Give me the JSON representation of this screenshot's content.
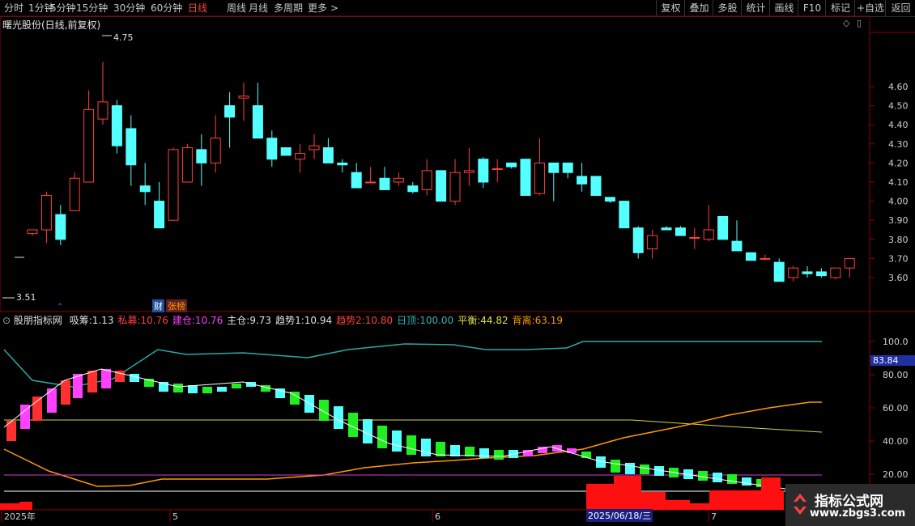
{
  "toolbar": {
    "periods": [
      "分时",
      "1分钟",
      "5分钟",
      "15分钟",
      "30分钟",
      "60分钟",
      "日线",
      "周线",
      "月线",
      "多周期",
      "更多 >"
    ],
    "active": "日线",
    "buttons": [
      "复权",
      "叠加",
      "多股",
      "统计",
      "画线",
      "F10",
      "标记",
      "+自选",
      "返回"
    ]
  },
  "main": {
    "title": "曙光股份(日线,前复权)",
    "high_label": "4.75",
    "low_label": "3.51",
    "badges": [
      "财",
      "张榜"
    ],
    "yaxis": [
      "4.60",
      "4.50",
      "4.40",
      "4.30",
      "4.20",
      "4.10",
      "4.00",
      "3.90",
      "3.80",
      "3.70",
      "3.60"
    ]
  },
  "indicator": {
    "name": "股朋指标网",
    "items": [
      {
        "label": "吸筹:",
        "value": "1.13",
        "color": "#e0e0e0"
      },
      {
        "label": "私募:",
        "value": "10.76",
        "color": "#ff4040"
      },
      {
        "label": "建仓:",
        "value": "10.76",
        "color": "#ff40ff"
      },
      {
        "label": "主仓:",
        "value": "9.73",
        "color": "#e0e0e0"
      },
      {
        "label": "趋势1:",
        "value": "10.94",
        "color": "#e0e0e0"
      },
      {
        "label": "趋势2:",
        "value": "10.80",
        "color": "#ff4040"
      },
      {
        "label": "日顶:",
        "value": "100.00",
        "color": "#33b5b5"
      },
      {
        "label": "平衡:",
        "value": "44.82",
        "color": "#e0e040"
      },
      {
        "label": "背离:",
        "value": "63.19",
        "color": "#ff9900"
      }
    ],
    "yaxis": [
      "100.0",
      "80.00",
      "60.00",
      "40.00",
      "20.00"
    ],
    "current": "83.84"
  },
  "xaxis": {
    "labels": [
      "2025年",
      "5",
      "6",
      "7"
    ],
    "cursor_date": "2025/06/18/三"
  },
  "watermark": {
    "title": "指标公式网",
    "url": "www.zbgs3.com"
  },
  "chart_data": {
    "type": "candlestick",
    "ylim": [
      3.5,
      4.8
    ],
    "candles": [
      [
        3.83,
        3.85,
        3.82,
        3.85
      ],
      [
        3.85,
        4.05,
        3.78,
        4.03
      ],
      [
        3.93,
        3.98,
        3.77,
        3.8
      ],
      [
        3.95,
        4.15,
        3.95,
        4.12
      ],
      [
        4.1,
        4.58,
        4.1,
        4.48
      ],
      [
        4.43,
        4.73,
        4.4,
        4.52
      ],
      [
        4.5,
        4.53,
        4.25,
        4.29
      ],
      [
        4.38,
        4.45,
        4.08,
        4.19
      ],
      [
        4.08,
        4.2,
        3.98,
        4.05
      ],
      [
        4.0,
        4.1,
        3.86,
        3.86
      ],
      [
        3.9,
        4.28,
        3.9,
        4.27
      ],
      [
        4.1,
        4.3,
        4.1,
        4.28
      ],
      [
        4.27,
        4.35,
        4.08,
        4.2
      ],
      [
        4.2,
        4.45,
        4.15,
        4.33
      ],
      [
        4.5,
        4.57,
        4.28,
        4.44
      ],
      [
        4.54,
        4.62,
        4.42,
        4.55
      ],
      [
        4.5,
        4.62,
        4.33,
        4.33
      ],
      [
        4.33,
        4.37,
        4.18,
        4.22
      ],
      [
        4.28,
        4.25,
        4.25,
        4.24
      ],
      [
        4.22,
        4.3,
        4.15,
        4.25
      ],
      [
        4.27,
        4.35,
        4.22,
        4.29
      ],
      [
        4.28,
        4.33,
        4.2,
        4.2
      ],
      [
        4.2,
        4.22,
        4.15,
        4.19
      ],
      [
        4.15,
        4.2,
        4.07,
        4.07
      ],
      [
        4.1,
        4.18,
        4.1,
        4.1
      ],
      [
        4.12,
        4.18,
        4.08,
        4.06
      ],
      [
        4.1,
        4.15,
        4.08,
        4.12
      ],
      [
        4.08,
        4.1,
        4.04,
        4.05
      ],
      [
        4.06,
        4.22,
        4.03,
        4.16
      ],
      [
        4.16,
        4.15,
        4.0,
        4.0
      ],
      [
        4.0,
        4.22,
        3.98,
        4.15
      ],
      [
        4.15,
        4.28,
        4.08,
        4.16
      ],
      [
        4.22,
        4.23,
        4.07,
        4.1
      ],
      [
        4.17,
        4.22,
        4.1,
        4.17
      ],
      [
        4.2,
        4.19,
        4.17,
        4.18
      ],
      [
        4.22,
        4.2,
        4.03,
        4.03
      ],
      [
        4.04,
        4.33,
        4.03,
        4.2
      ],
      [
        4.2,
        4.18,
        4.0,
        4.15
      ],
      [
        4.2,
        4.15,
        4.12,
        4.15
      ],
      [
        4.13,
        4.2,
        4.05,
        4.09
      ],
      [
        4.13,
        4.1,
        4.05,
        4.03
      ],
      [
        4.02,
        4.01,
        3.99,
        4.0
      ],
      [
        4.0,
        4.0,
        3.86,
        3.86
      ],
      [
        3.86,
        3.87,
        3.7,
        3.73
      ],
      [
        3.75,
        3.85,
        3.7,
        3.82
      ],
      [
        3.86,
        3.87,
        3.85,
        3.85
      ],
      [
        3.86,
        3.87,
        3.82,
        3.82
      ],
      [
        3.81,
        3.86,
        3.75,
        3.81
      ],
      [
        3.8,
        3.98,
        3.79,
        3.85
      ],
      [
        3.92,
        3.92,
        3.8,
        3.8
      ],
      [
        3.79,
        3.9,
        3.74,
        3.74
      ],
      [
        3.73,
        3.73,
        3.69,
        3.69
      ],
      [
        3.7,
        3.72,
        3.69,
        3.7
      ],
      [
        3.68,
        3.7,
        3.58,
        3.58
      ],
      [
        3.6,
        3.66,
        3.58,
        3.65
      ],
      [
        3.63,
        3.66,
        3.6,
        3.62
      ],
      [
        3.63,
        3.65,
        3.6,
        3.61
      ],
      [
        3.6,
        3.65,
        3.59,
        3.65
      ],
      [
        3.65,
        3.7,
        3.6,
        3.7
      ]
    ]
  }
}
